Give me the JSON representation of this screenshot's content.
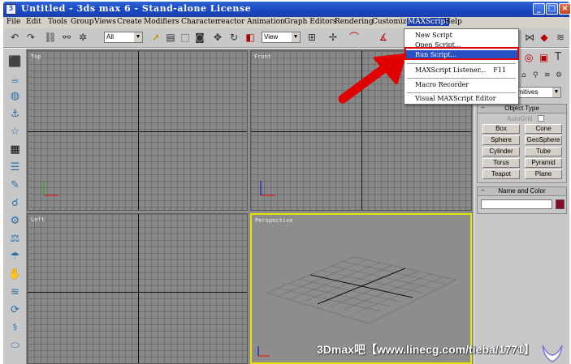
{
  "window": {
    "title": "Untitled - 3ds max 6 - Stand-alone License",
    "buttons": [
      "_",
      "□",
      "×"
    ]
  },
  "menubar": {
    "items": [
      "File",
      "Edit",
      "Tools",
      "Group",
      "Views",
      "Create",
      "Modifiers",
      "Character",
      "reactor",
      "Animation",
      "Graph Editors",
      "Rendering",
      "Customize",
      "MAXScript",
      "Help"
    ],
    "active": "MAXScript"
  },
  "toolbar": {
    "selection_filter": "All",
    "reference_coord": "View"
  },
  "maxscript_menu": {
    "items": [
      {
        "label": "New Script",
        "shortcut": ""
      },
      {
        "label": "Open Script...",
        "shortcut": ""
      },
      {
        "label": "Run Script...",
        "shortcut": "",
        "highlighted": true
      },
      {
        "label": "MAXScript Listener...",
        "shortcut": "F11"
      },
      {
        "label": "Macro Recorder",
        "shortcut": ""
      },
      {
        "label": "Visual MAXScript Editor",
        "shortcut": ""
      }
    ]
  },
  "viewports": [
    {
      "label": "Top"
    },
    {
      "label": "Front"
    },
    {
      "label": "Left"
    },
    {
      "label": "Perspective",
      "active": true
    }
  ],
  "command_panel": {
    "category_dropdown": "Standard Primitives",
    "object_type": {
      "title": "Object Type",
      "autogrid": "AutoGrid",
      "buttons": [
        "Box",
        "Cone",
        "Sphere",
        "GeoSphere",
        "Cylinder",
        "Tube",
        "Torus",
        "Pyramid",
        "Teapot",
        "Plane"
      ]
    },
    "name_and_color": {
      "title": "Name and Color",
      "color": "#8b0a2a"
    }
  },
  "watermark": "3Dmax吧【www.linecg.com/tieba/1771】",
  "colors": {
    "titlebar": "#1847c1",
    "menu_highlight": "#2651c4",
    "annotation_arrow": "#e00000",
    "active_viewport_border": "#e8e000"
  }
}
